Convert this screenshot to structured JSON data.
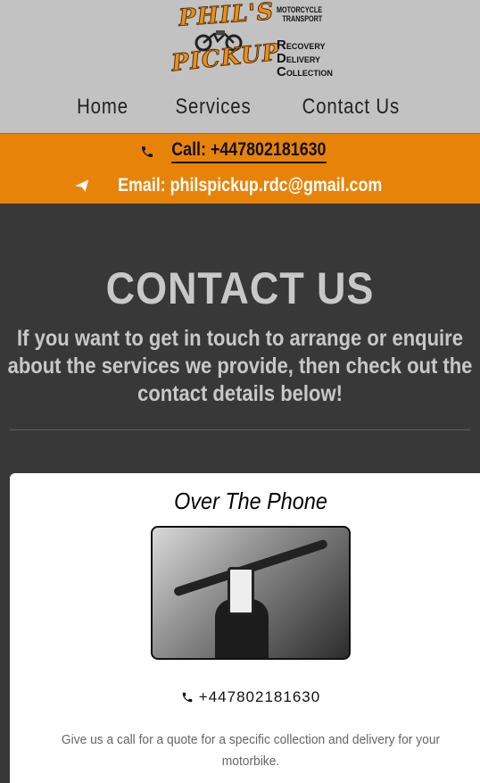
{
  "logo": {
    "line1": "PHIL'S",
    "line2": "PICKUP",
    "tag1": "MOTORCYCLE",
    "tag2": "TRANSPORT",
    "rdc": [
      {
        "cap": "R",
        "rest": "ECOVERY"
      },
      {
        "cap": "D",
        "rest": "ELIVERY"
      },
      {
        "cap": "C",
        "rest": "OLLECTION"
      }
    ]
  },
  "nav": [
    "Home",
    "Services",
    "Contact Us"
  ],
  "contact_bar": {
    "call": "Call: +447802181630",
    "email": "Email: philspickup.rdc@gmail.com"
  },
  "hero": {
    "title": "CONTACT US",
    "text": "If you want to get in touch to arrange or enquire about the services we provide, then check out the contact details below!"
  },
  "card": {
    "title": "Over The Phone",
    "phone": "+447802181630",
    "text": "Give us a call for a quote for a specific collection and delivery for your motorbike."
  },
  "colors": {
    "header_bg": "#c2c2c2",
    "accent": "#e8830a",
    "page_bg": "#383838",
    "card_bg": "#ffffff"
  },
  "icons": [
    "phone-icon",
    "paper-plane-icon"
  ]
}
